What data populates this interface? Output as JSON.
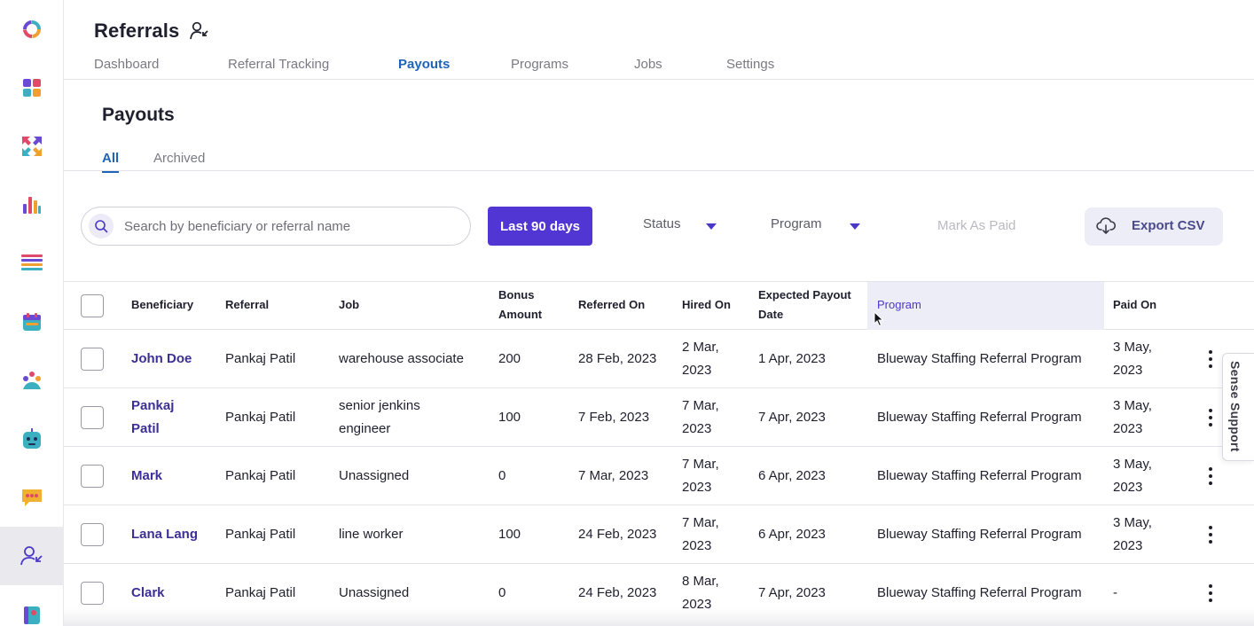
{
  "app": {
    "title": "Referrals"
  },
  "nav": {
    "tabs": [
      {
        "label": "Dashboard"
      },
      {
        "label": "Referral Tracking"
      },
      {
        "label": "Payouts"
      },
      {
        "label": "Programs"
      },
      {
        "label": "Jobs"
      },
      {
        "label": "Settings"
      }
    ],
    "active": "Payouts"
  },
  "page": {
    "title": "Payouts",
    "subtabs": [
      {
        "label": "All"
      },
      {
        "label": "Archived"
      }
    ]
  },
  "toolbar": {
    "search_placeholder": "Search by beneficiary or referral name",
    "date_range_label": "Last 90 days",
    "status_label": "Status",
    "program_label": "Program",
    "mark_paid_label": "Mark As Paid",
    "export_label": "Export CSV"
  },
  "table": {
    "headers": {
      "beneficiary": "Beneficiary",
      "referral": "Referral",
      "job": "Job",
      "bonus_line1": "Bonus",
      "bonus_line2": "Amount",
      "referred_on": "Referred On",
      "hired_on": "Hired On",
      "expected_line1": "Expected Payout",
      "expected_line2": "Date",
      "program": "Program",
      "paid_on": "Paid On"
    },
    "rows": [
      {
        "beneficiary_1": "John Doe",
        "beneficiary_2": "",
        "referral": "Pankaj Patil",
        "job_1": "warehouse associate",
        "job_2": "",
        "bonus": "200",
        "referred_on": "28 Feb, 2023",
        "hired_1": "2 Mar,",
        "hired_2": "2023",
        "expected": "1 Apr, 2023",
        "program": "Blueway Staffing Referral Program",
        "paid_1": "3 May,",
        "paid_2": "2023"
      },
      {
        "beneficiary_1": "Pankaj",
        "beneficiary_2": "Patil",
        "referral": "Pankaj Patil",
        "job_1": "senior jenkins",
        "job_2": "engineer",
        "bonus": "100",
        "referred_on": "7 Feb, 2023",
        "hired_1": "7 Mar,",
        "hired_2": "2023",
        "expected": "7 Apr, 2023",
        "program": "Blueway Staffing Referral Program",
        "paid_1": "3 May,",
        "paid_2": "2023"
      },
      {
        "beneficiary_1": "Mark",
        "beneficiary_2": "",
        "referral": "Pankaj Patil",
        "job_1": "Unassigned",
        "job_2": "",
        "bonus": "0",
        "referred_on": "7 Mar, 2023",
        "hired_1": "7 Mar,",
        "hired_2": "2023",
        "expected": "6 Apr, 2023",
        "program": "Blueway Staffing Referral Program",
        "paid_1": "3 May,",
        "paid_2": "2023"
      },
      {
        "beneficiary_1": "Lana Lang",
        "beneficiary_2": "",
        "referral": "Pankaj Patil",
        "job_1": "line worker",
        "job_2": "",
        "bonus": "100",
        "referred_on": "24 Feb, 2023",
        "hired_1": "7 Mar,",
        "hired_2": "2023",
        "expected": "6 Apr, 2023",
        "program": "Blueway Staffing Referral Program",
        "paid_1": "3 May,",
        "paid_2": "2023"
      },
      {
        "beneficiary_1": "Clark",
        "beneficiary_2": "",
        "referral": "Pankaj Patil",
        "job_1": "Unassigned",
        "job_2": "",
        "bonus": "0",
        "referred_on": "24 Feb, 2023",
        "hired_1": "8 Mar,",
        "hired_2": "2023",
        "expected": "7 Apr, 2023",
        "program": "Blueway Staffing Referral Program",
        "paid_1": "-",
        "paid_2": ""
      }
    ]
  },
  "support": {
    "label": "Sense Support"
  },
  "colors": {
    "accent": "#5236d4",
    "link": "#1e63b8",
    "name": "#3c2f95",
    "highlight": "#ededf8"
  }
}
